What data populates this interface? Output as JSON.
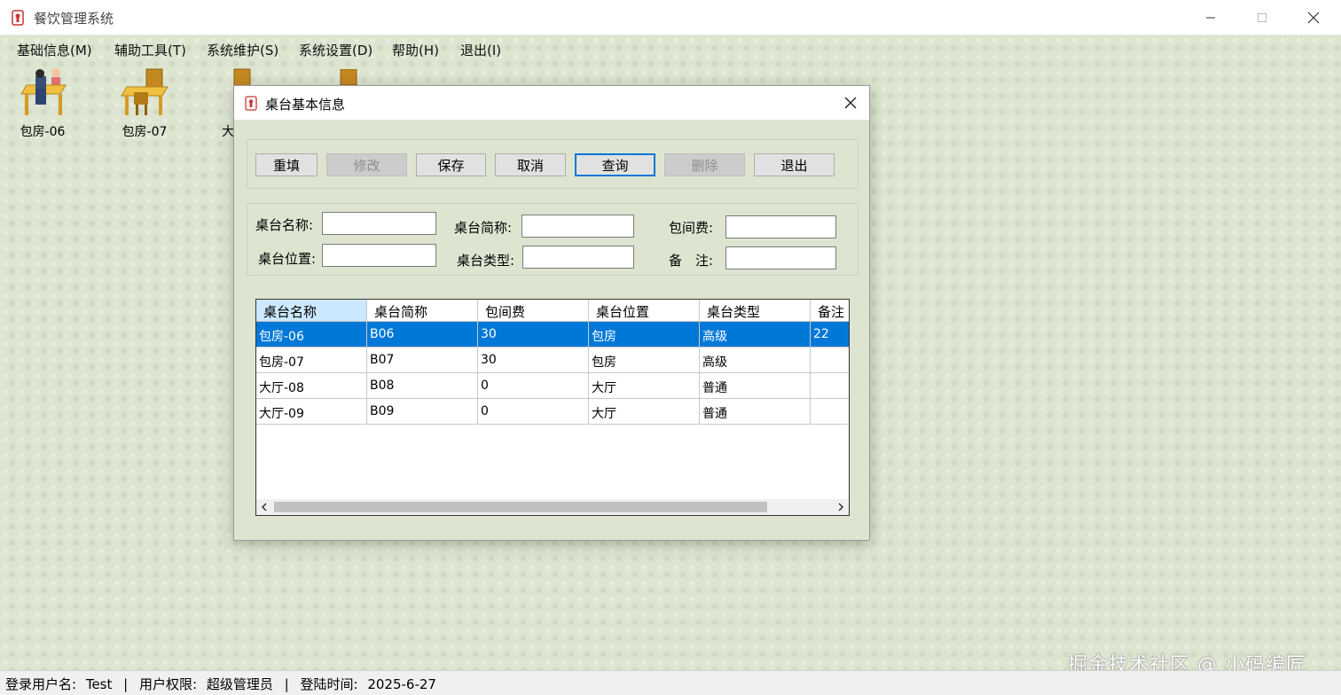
{
  "window": {
    "title": "餐饮管理系统"
  },
  "menu": [
    {
      "label": "基础信息(M)"
    },
    {
      "label": "辅助工具(T)"
    },
    {
      "label": "系统维护(S)"
    },
    {
      "label": "系统设置(D)"
    },
    {
      "label": "帮助(H)"
    },
    {
      "label": "退出(I)"
    }
  ],
  "desktop_tables": [
    {
      "label": "包房-06",
      "icon": "occupied-table-icon"
    },
    {
      "label": "包房-07",
      "icon": "table-icon"
    },
    {
      "label": "大",
      "icon": "table-icon"
    }
  ],
  "dialog": {
    "title": "桌台基本信息",
    "buttons": [
      {
        "label": "重填",
        "state": "normal"
      },
      {
        "label": "修改",
        "state": "disabled"
      },
      {
        "label": "保存",
        "state": "normal"
      },
      {
        "label": "取消",
        "state": "normal"
      },
      {
        "label": "查询",
        "state": "focused"
      },
      {
        "label": "删除",
        "state": "disabled"
      },
      {
        "label": "退出",
        "state": "normal"
      }
    ],
    "fields": {
      "name_label": "桌台名称:",
      "short_label": "桌台简称:",
      "fee_label": "包间费:",
      "location_label": "桌台位置:",
      "type_label": "桌台类型:",
      "remark_label": "备　注:",
      "name_value": "",
      "short_value": "",
      "fee_value": "",
      "location_value": "",
      "type_value": "",
      "remark_value": ""
    },
    "grid": {
      "columns": [
        "桌台名称",
        "桌台简称",
        "包间费",
        "桌台位置",
        "桌台类型",
        "备注"
      ],
      "selected_row": 0,
      "rows": [
        [
          "包房-06",
          "B06",
          "30",
          "包房",
          "高级",
          "22"
        ],
        [
          "包房-07",
          "B07",
          "30",
          "包房",
          "高级",
          ""
        ],
        [
          "大厅-08",
          "B08",
          "0",
          "大厅",
          "普通",
          ""
        ],
        [
          "大厅-09",
          "B09",
          "0",
          "大厅",
          "普通",
          ""
        ]
      ]
    }
  },
  "status": {
    "user_label": "登录用户名:",
    "user_value": "Test",
    "role_label": "用户权限:",
    "role_value": "超级管理员",
    "time_label": "登陆时间:",
    "time_value": "2025-6-27",
    "separator": "|"
  },
  "watermark": "掘金技术社区 @ 小码编匠",
  "colors": {
    "selection": "#0078d7",
    "desktop": "#dde5d1",
    "table_wood": "#e8b030"
  }
}
